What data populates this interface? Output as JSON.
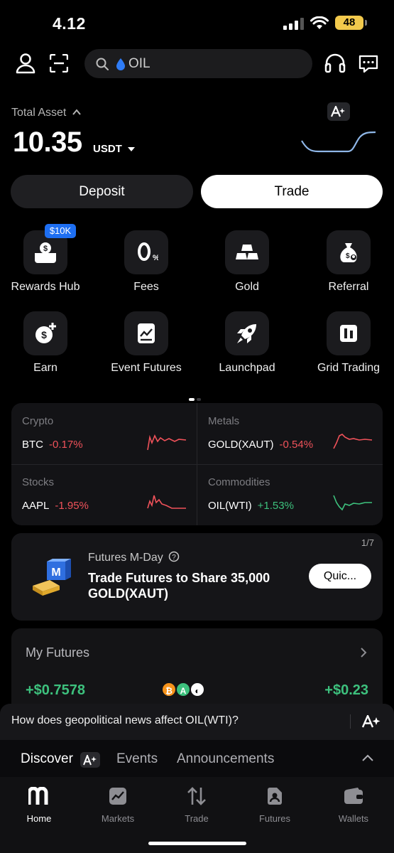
{
  "status_bar": {
    "time": "4.12",
    "battery": "48"
  },
  "search": {
    "text": "OIL"
  },
  "asset": {
    "label": "Total Asset",
    "value": "10.35",
    "unit": "USDT"
  },
  "actions": {
    "deposit": "Deposit",
    "trade": "Trade"
  },
  "shortcuts": {
    "promo_tag": "$10K",
    "row1": [
      {
        "label": "Rewards Hub",
        "icon": "rewards-icon"
      },
      {
        "label": "Fees",
        "icon": "fees-icon"
      },
      {
        "label": "Gold",
        "icon": "gold-bars-icon"
      },
      {
        "label": "Referral",
        "icon": "referral-icon"
      }
    ],
    "row2": [
      {
        "label": "Earn",
        "icon": "earn-icon"
      },
      {
        "label": "Event Futures",
        "icon": "event-futures-icon"
      },
      {
        "label": "Launchpad",
        "icon": "rocket-icon"
      },
      {
        "label": "Grid Trading",
        "icon": "grid-trading-icon"
      }
    ]
  },
  "markets": [
    {
      "category": "Crypto",
      "symbol": "BTC",
      "change": "-0.17%"
    },
    {
      "category": "Metals",
      "symbol": "GOLD(XAUT)",
      "change": "-0.54%"
    },
    {
      "category": "Stocks",
      "symbol": "AAPL",
      "change": "-1.95%"
    },
    {
      "category": "Commodities",
      "symbol": "OIL(WTI)",
      "change": "+1.53%"
    }
  ],
  "banner": {
    "page": "1/7",
    "subtitle": "Futures M-Day",
    "title": "Trade Futures to Share 35,000 GOLD(XAUT)",
    "button": "Quic..."
  },
  "my_futures": {
    "title": "My Futures",
    "left_value": "+$0.7578",
    "right_value": "+$0.23"
  },
  "ai_question": {
    "text": "How does geopolitical news affect OIL(WTI)?"
  },
  "tabs": {
    "discover": "Discover",
    "events": "Events",
    "announcements": "Announcements"
  },
  "nav": [
    {
      "label": "Home",
      "icon": "home-icon"
    },
    {
      "label": "Markets",
      "icon": "markets-icon"
    },
    {
      "label": "Trade",
      "icon": "trade-arrows-icon"
    },
    {
      "label": "Futures",
      "icon": "futures-icon"
    },
    {
      "label": "Wallets",
      "icon": "wallet-icon"
    }
  ],
  "colors": {
    "positive": "#3dc17d",
    "negative": "#f0525a",
    "accent": "#1e6ff2",
    "battery": "#f2c94c"
  }
}
